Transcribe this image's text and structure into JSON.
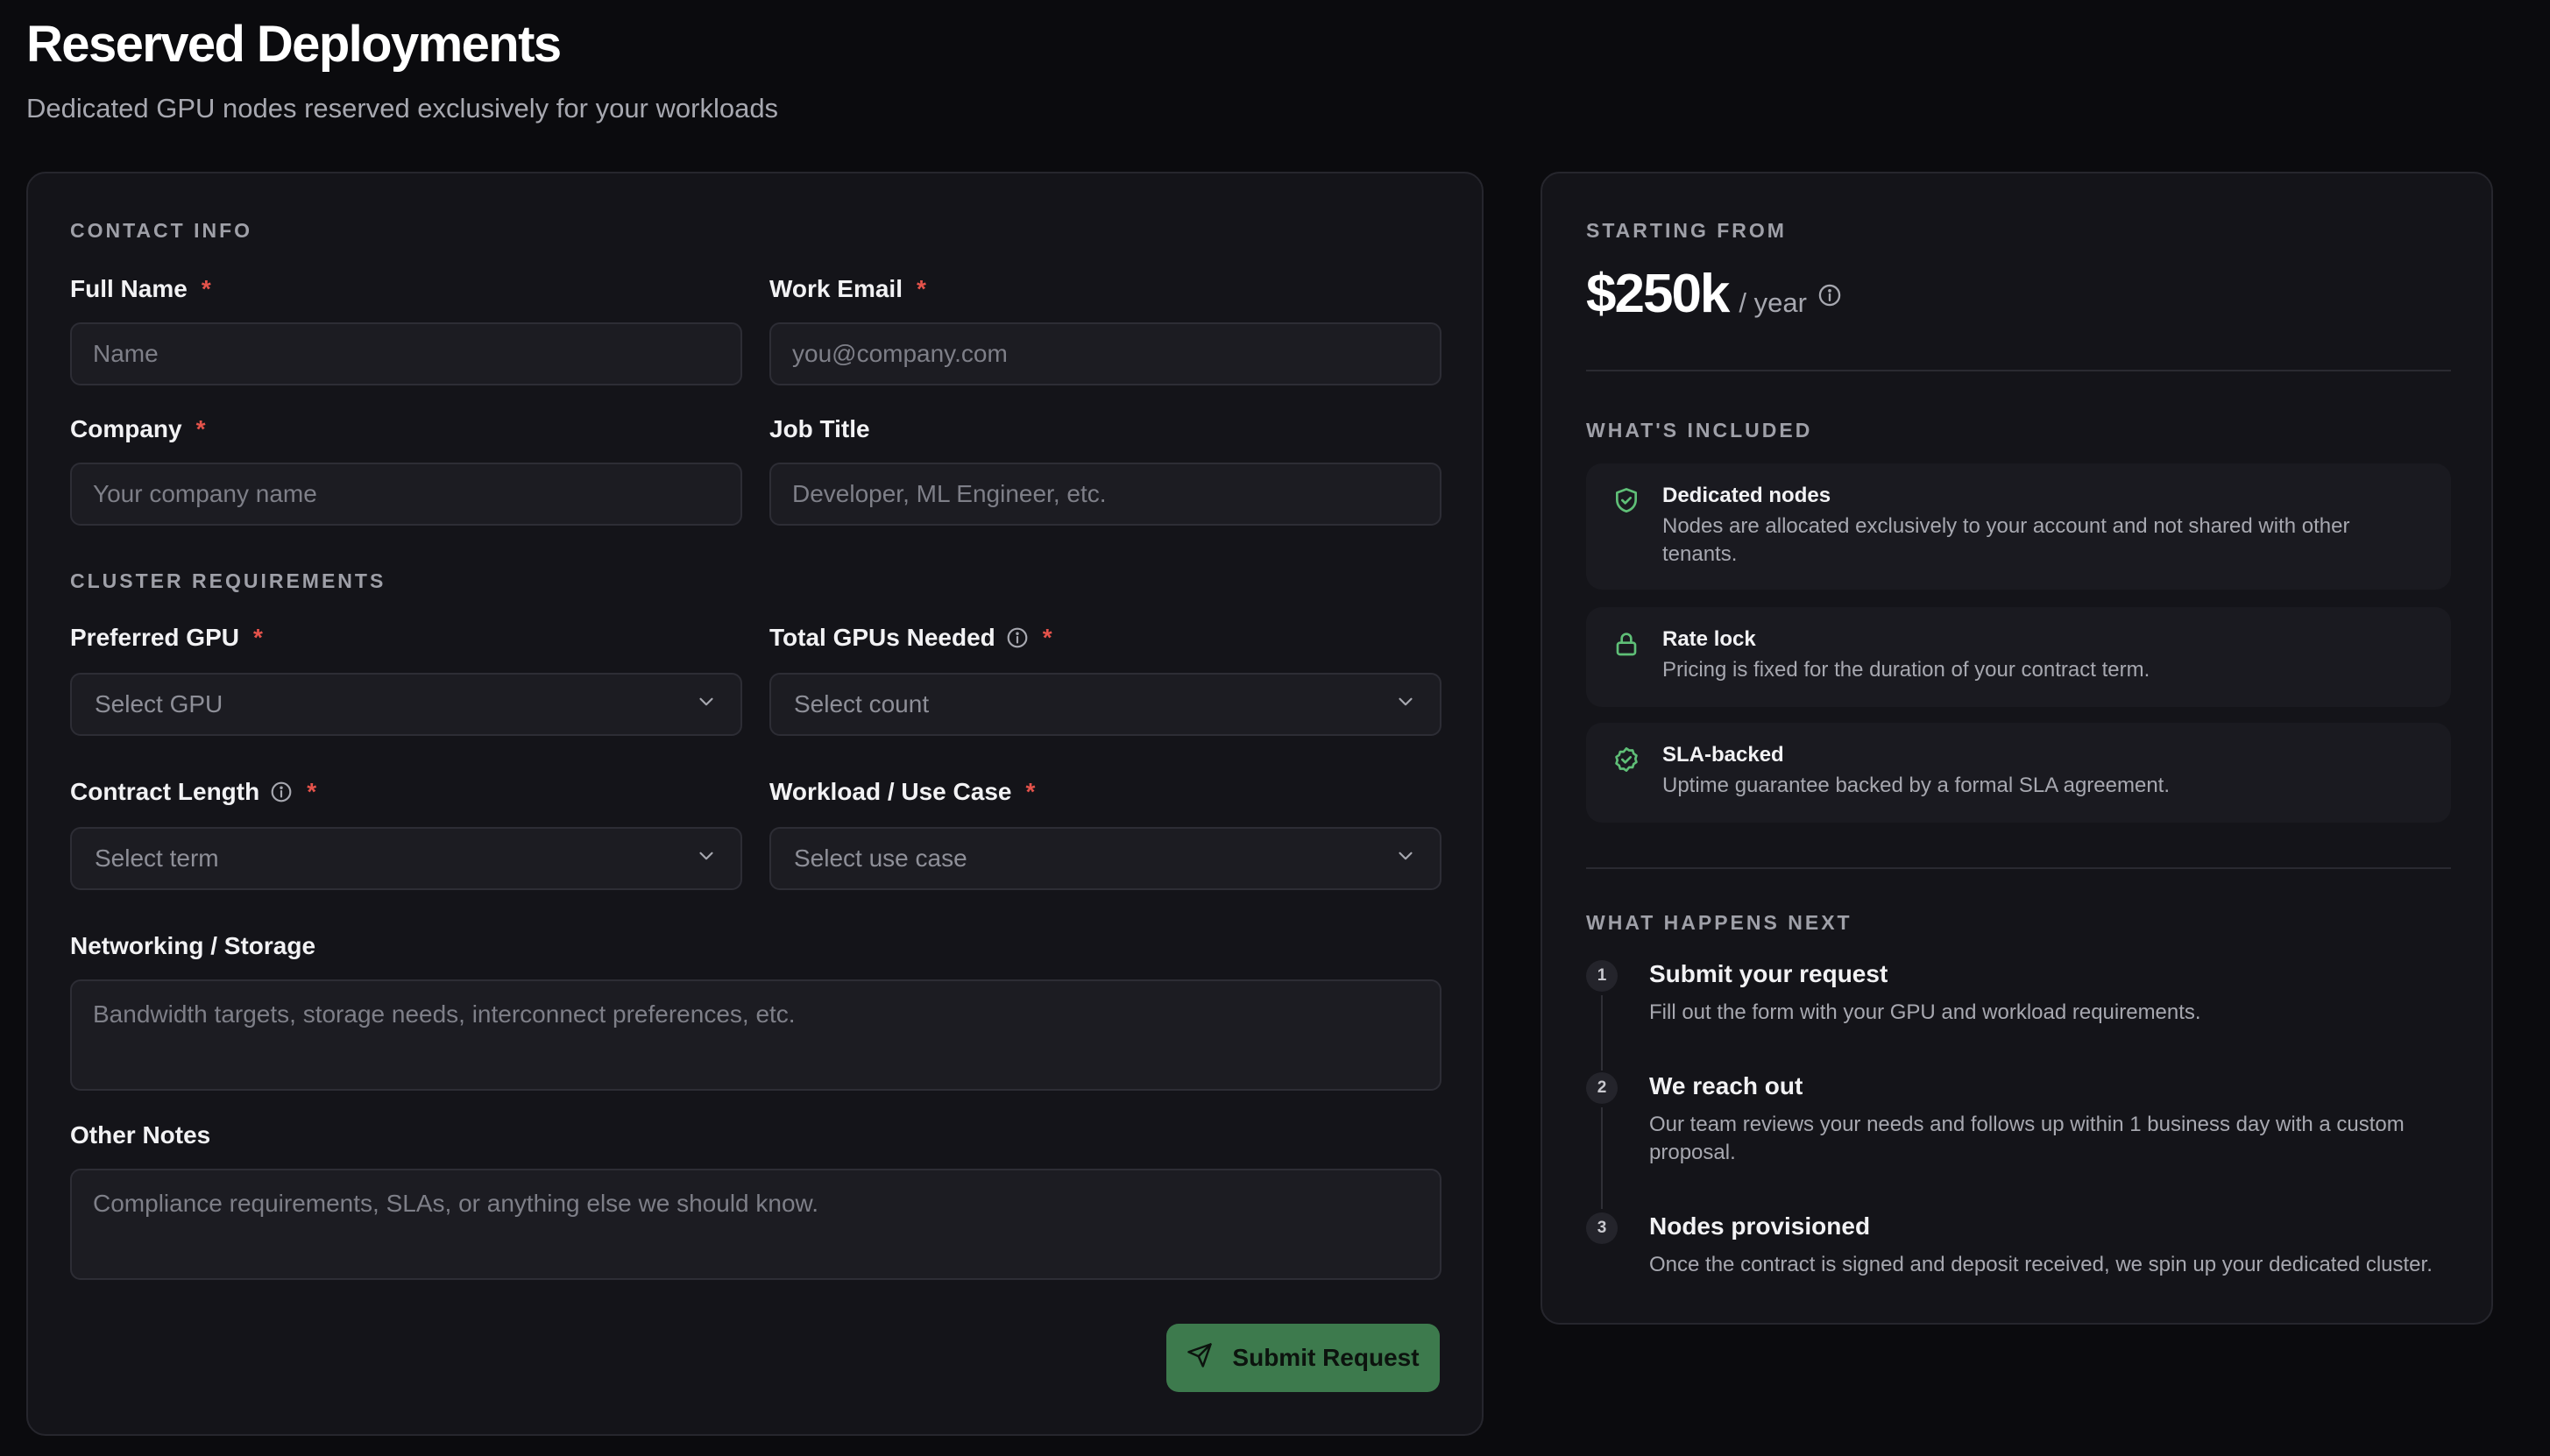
{
  "header": {
    "title": "Reserved Deployments",
    "subtitle": "Dedicated GPU nodes reserved exclusively for your workloads"
  },
  "form": {
    "contact_section": "CONTACT INFO",
    "full_name": {
      "label": "Full Name",
      "placeholder": "Name",
      "required": "*"
    },
    "work_email": {
      "label": "Work Email",
      "placeholder": "you@company.com",
      "required": "*"
    },
    "company": {
      "label": "Company",
      "placeholder": "Your company name",
      "required": "*"
    },
    "job_title": {
      "label": "Job Title",
      "placeholder": "Developer, ML Engineer, etc."
    },
    "cluster_section": "CLUSTER REQUIREMENTS",
    "preferred_gpu": {
      "label": "Preferred GPU",
      "value": "Select GPU",
      "required": "*"
    },
    "total_gpus": {
      "label": "Total GPUs Needed",
      "value": "Select count",
      "required": "*"
    },
    "contract_length": {
      "label": "Contract Length",
      "value": "Select term",
      "required": "*"
    },
    "workload": {
      "label": "Workload / Use Case",
      "value": "Select use case",
      "required": "*"
    },
    "networking": {
      "label": "Networking / Storage",
      "placeholder": "Bandwidth targets, storage needs, interconnect preferences, etc."
    },
    "other_notes": {
      "label": "Other Notes",
      "placeholder": "Compliance requirements, SLAs, or anything else we should know."
    },
    "submit_label": "Submit Request"
  },
  "pricing": {
    "label": "STARTING FROM",
    "amount": "$250k",
    "unit": "/ year"
  },
  "included": {
    "label": "WHAT'S INCLUDED",
    "items": [
      {
        "icon": "shield-check-icon",
        "title": "Dedicated nodes",
        "desc": "Nodes are allocated exclusively to your account and not shared with other tenants."
      },
      {
        "icon": "lock-icon",
        "title": "Rate lock",
        "desc": "Pricing is fixed for the duration of your contract term."
      },
      {
        "icon": "check-badge-icon",
        "title": "SLA-backed",
        "desc": "Uptime guarantee backed by a formal SLA agreement."
      }
    ]
  },
  "next_steps": {
    "label": "WHAT HAPPENS NEXT",
    "steps": [
      {
        "num": "1",
        "title": "Submit your request",
        "desc": "Fill out the form with your GPU and workload requirements."
      },
      {
        "num": "2",
        "title": "We reach out",
        "desc": "Our team reviews your needs and follows up within 1 business day with a custom proposal."
      },
      {
        "num": "3",
        "title": "Nodes provisioned",
        "desc": "Once the contract is signed and deposit received, we spin up your dedicated cluster."
      }
    ]
  },
  "colors": {
    "background": "#0b0b0e",
    "card": "#141419",
    "accent_green": "#3d7a4d",
    "icon_green": "#5fbf77",
    "required_red": "#e5534b"
  }
}
